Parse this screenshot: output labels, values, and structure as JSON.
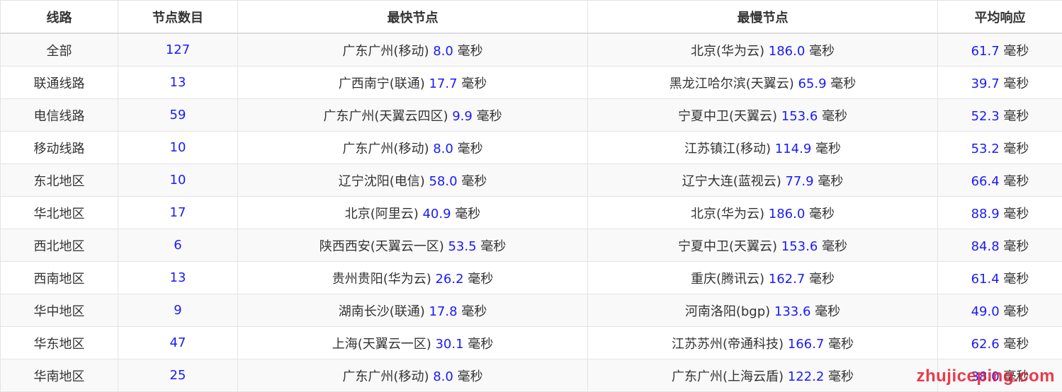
{
  "headers": [
    "线路",
    "节点数目",
    "最快节点",
    "最慢节点",
    "平均响应"
  ],
  "unit": "毫秒",
  "rows": [
    {
      "line": "全部",
      "count": "127",
      "fast_node": "广东广州(移动)",
      "fast_ms": "8.0",
      "slow_node": "北京(华为云)",
      "slow_ms": "186.0",
      "avg_ms": "61.7"
    },
    {
      "line": "联通线路",
      "count": "13",
      "fast_node": "广西南宁(联通)",
      "fast_ms": "17.7",
      "slow_node": "黑龙江哈尔滨(天翼云)",
      "slow_ms": "65.9",
      "avg_ms": "39.7"
    },
    {
      "line": "电信线路",
      "count": "59",
      "fast_node": "广东广州(天翼云四区)",
      "fast_ms": "9.9",
      "slow_node": "宁夏中卫(天翼云)",
      "slow_ms": "153.6",
      "avg_ms": "52.3"
    },
    {
      "line": "移动线路",
      "count": "10",
      "fast_node": "广东广州(移动)",
      "fast_ms": "8.0",
      "slow_node": "江苏镇江(移动)",
      "slow_ms": "114.9",
      "avg_ms": "53.2"
    },
    {
      "line": "东北地区",
      "count": "10",
      "fast_node": "辽宁沈阳(电信)",
      "fast_ms": "58.0",
      "slow_node": "辽宁大连(蓝视云)",
      "slow_ms": "77.9",
      "avg_ms": "66.4"
    },
    {
      "line": "华北地区",
      "count": "17",
      "fast_node": "北京(阿里云)",
      "fast_ms": "40.9",
      "slow_node": "北京(华为云)",
      "slow_ms": "186.0",
      "avg_ms": "88.9"
    },
    {
      "line": "西北地区",
      "count": "6",
      "fast_node": "陕西西安(天翼云一区)",
      "fast_ms": "53.5",
      "slow_node": "宁夏中卫(天翼云)",
      "slow_ms": "153.6",
      "avg_ms": "84.8"
    },
    {
      "line": "西南地区",
      "count": "13",
      "fast_node": "贵州贵阳(华为云)",
      "fast_ms": "26.2",
      "slow_node": "重庆(腾讯云)",
      "slow_ms": "162.7",
      "avg_ms": "61.4"
    },
    {
      "line": "华中地区",
      "count": "9",
      "fast_node": "湖南长沙(联通)",
      "fast_ms": "17.8",
      "slow_node": "河南洛阳(bgp)",
      "slow_ms": "133.6",
      "avg_ms": "49.0"
    },
    {
      "line": "华东地区",
      "count": "47",
      "fast_node": "上海(天翼云一区)",
      "fast_ms": "30.1",
      "slow_node": "江苏苏州(帝通科技)",
      "slow_ms": "166.7",
      "avg_ms": "62.6"
    },
    {
      "line": "华南地区",
      "count": "25",
      "fast_node": "广东广州(移动)",
      "fast_ms": "8.0",
      "slow_node": "广东广州(上海云盾)",
      "slow_ms": "122.2",
      "avg_ms": "38.0"
    }
  ],
  "watermark": "zhujiceping.com",
  "colors": {
    "number": "#1a1aff",
    "text": "#333333",
    "border": "#e4e4e4",
    "stripe": "#f9f9f9",
    "watermark": "#e8192c"
  }
}
